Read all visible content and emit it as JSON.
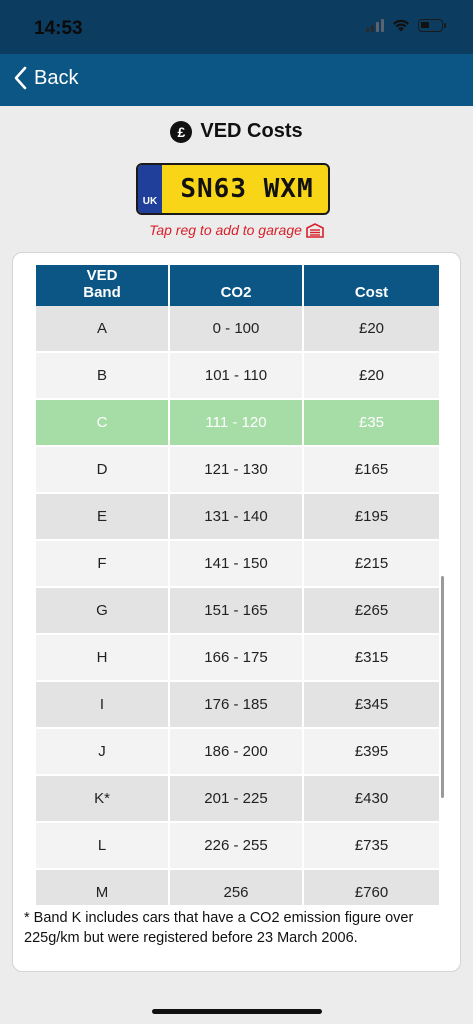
{
  "status_bar": {
    "time": "14:53"
  },
  "nav": {
    "back_label": "Back"
  },
  "header": {
    "title": "VED Costs",
    "currency_symbol": "£"
  },
  "plate": {
    "country": "UK",
    "registration": "SN63 WXM"
  },
  "tap_hint": "Tap reg to add to garage",
  "table": {
    "headers": [
      "VED\nBand",
      "CO2",
      "Cost"
    ],
    "rows": [
      {
        "band": "A",
        "co2": "0 - 100",
        "cost": "£20"
      },
      {
        "band": "B",
        "co2": "101 - 110",
        "cost": "£20"
      },
      {
        "band": "C",
        "co2": "111 - 120",
        "cost": "£35",
        "highlighted": true
      },
      {
        "band": "D",
        "co2": "121 - 130",
        "cost": "£165"
      },
      {
        "band": "E",
        "co2": "131 - 140",
        "cost": "£195"
      },
      {
        "band": "F",
        "co2": "141 - 150",
        "cost": "£215"
      },
      {
        "band": "G",
        "co2": "151 - 165",
        "cost": "£265"
      },
      {
        "band": "H",
        "co2": "166 - 175",
        "cost": "£315"
      },
      {
        "band": "I",
        "co2": "176 - 185",
        "cost": "£345"
      },
      {
        "band": "J",
        "co2": "186 - 200",
        "cost": "£395"
      },
      {
        "band": "K*",
        "co2": "201 - 225",
        "cost": "£430"
      },
      {
        "band": "L",
        "co2": "226 - 255",
        "cost": "£735"
      },
      {
        "band": "M",
        "co2": "256",
        "cost": "£760"
      }
    ]
  },
  "footnote": "* Band K includes cars that have a CO2 emission figure over 225g/km but were registered before 23 March 2006.",
  "colors": {
    "nav_blue": "#0b5685",
    "status_bar": "#0c3c5f",
    "highlight_green": "#a6dca6",
    "plate_yellow": "#f8d516",
    "plate_band_blue": "#1f3f9a",
    "hint_red": "#d8202a"
  },
  "icons": [
    "back-chevron-icon",
    "pound-icon",
    "garage-icon",
    "wifi-icon",
    "signal-icon",
    "battery-icon"
  ]
}
